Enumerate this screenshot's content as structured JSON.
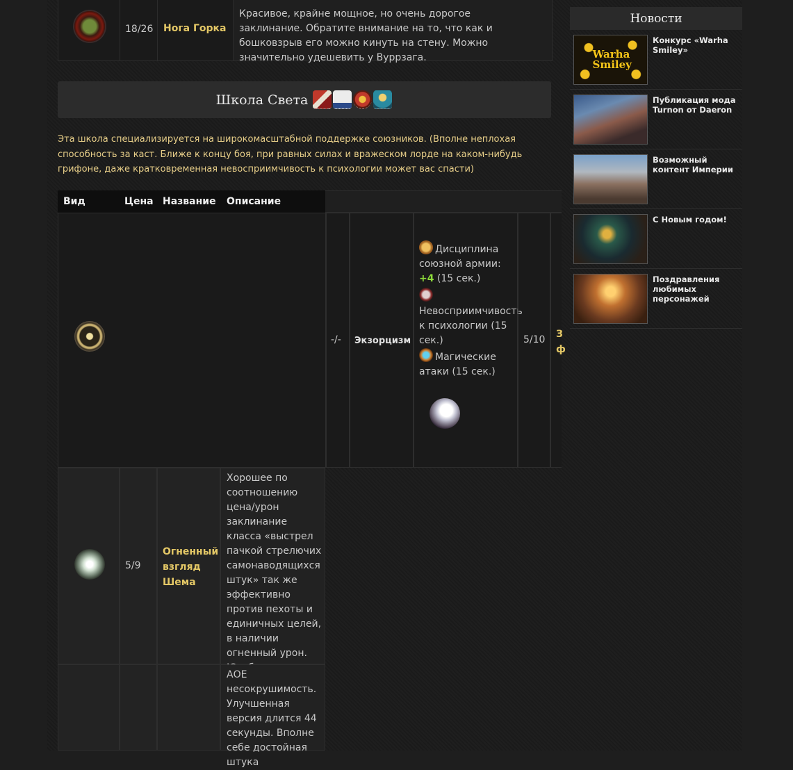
{
  "top_row": {
    "cost": "18/26",
    "name": "Нога Горка",
    "description": "Красивое, крайне мощное, но очень дорогое заклинание. Обратите внимание на то, что как и бошковзрыв его можно кинуть на стену. Можно значительно удешевить у Вуррзага."
  },
  "school": {
    "title": "Школа Света",
    "faction_icons": [
      "bretonnia-banner-icon",
      "empire-banner-icon",
      "cathay-sun-icon",
      "high-elves-crest-icon"
    ],
    "intro": "Эта школа специализируется на широкомасштабной поддержке союзников. (Вполне неплохая способность за каст. Ближе к концу боя, при равных силах и вражеском лорде на каком-нибудь грифоне, даже кратковременная невосприимчивость к психологии может вас спасти)"
  },
  "table": {
    "headers": [
      "Вид",
      "Цена",
      "Название",
      "Описание"
    ],
    "rows": [
      {
        "icon": "wheel-of-light-icon",
        "cost": "-/-",
        "name": "Экзорцизм",
        "effects": [
          {
            "icon": "discipline-icon",
            "text": "Дисциплина союзной армии:",
            "bonus": "+4",
            "duration": "(15 сек.)"
          },
          {
            "icon": "immunity-icon",
            "text": "Невосприимчивость к психологии",
            "duration": "(15 сек.)"
          },
          {
            "icon": "magic-attacks-icon",
            "text": "Магические атаки",
            "duration": "(15 сек.)"
          }
        ],
        "extra_icon": "light-orb-icon",
        "cost2": "5/10",
        "cut_text": "З",
        "cut_text2": "ф"
      },
      {
        "icon": "shems-burning-gaze-icon",
        "cost": "5/9",
        "name": "Огненный взгляд Шема",
        "description": "Хорошее по соотношению цена/урон заклинание класса «выстрел пачкой стрелючих самонаводящихся штук» так же эффективно против пехоты и единичных целей, в наличии огненный урон. Юзабельно."
      },
      {
        "icon": "",
        "cost": "",
        "name": "",
        "description": "АОЕ несокрушимость. Улучшенная версия длится 44 секунды. Вполне себе достойная штука"
      }
    ]
  },
  "news": {
    "title": "Новости",
    "items": [
      {
        "title": "Конкурс «Warha Smiley»",
        "thumb_text": "Warha Smiley"
      },
      {
        "title": "Публикация мода Turnon от Daeron"
      },
      {
        "title": "Возможный контент Империи"
      },
      {
        "title": "С Новым годом!"
      },
      {
        "title": "Поздравления любимых персонажей"
      }
    ]
  }
}
